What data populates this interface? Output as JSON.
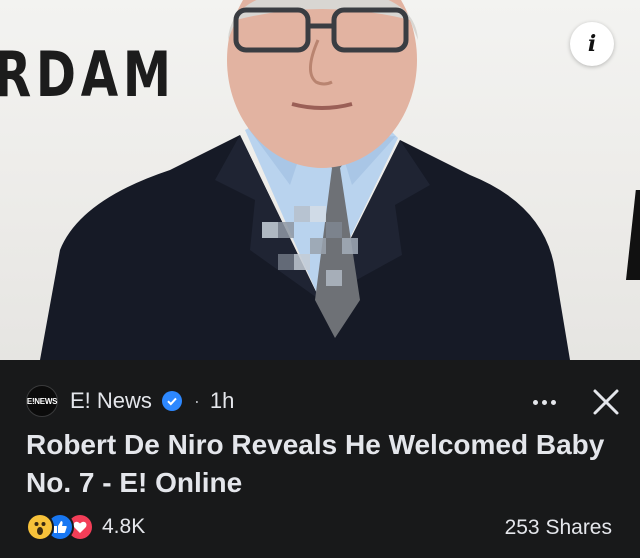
{
  "photo": {
    "backdrop_text": "RDAM",
    "blur_region": true
  },
  "info_button": {
    "icon": "info-icon",
    "glyph": "i"
  },
  "post": {
    "source": {
      "avatar_text": "E!NEWS",
      "name": "E! News",
      "verified": true,
      "separator": "·",
      "time": "1h"
    },
    "headline": "Robert De Niro Reveals He Welcomed Baby No. 7 - E! Online",
    "reactions": {
      "types": [
        "wow-icon",
        "like-icon",
        "love-icon"
      ],
      "count": "4.8K"
    },
    "shares": "253 Shares"
  },
  "actions": {
    "more": "more-options-icon",
    "close": "close-icon"
  },
  "colors": {
    "panel_bg": "#18191a",
    "text": "#e4e6eb",
    "verified_blue": "#2d88ff",
    "like_blue": "#1877f2",
    "love_red": "#f33e58",
    "wow_yellow": "#f7c23a"
  }
}
